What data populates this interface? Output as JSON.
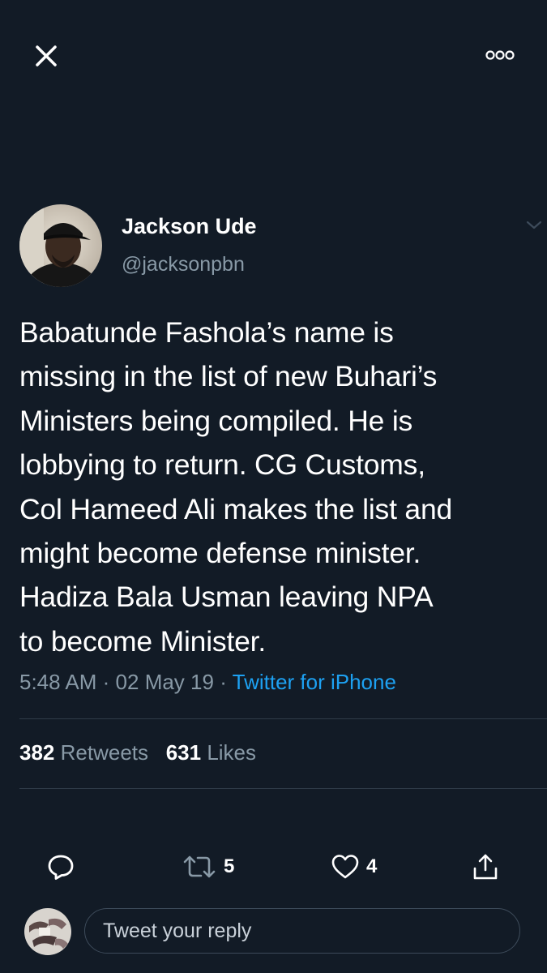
{
  "header": {
    "close_icon": "close-icon",
    "more_icon": "more-options-icon"
  },
  "tweet": {
    "author": {
      "display_name": "Jackson Ude",
      "handle": "@jacksonpbn",
      "avatar_icon": "profile-photo"
    },
    "text": "Babatunde Fashola’s name is\nmissing in the list of new Buhari’s\nMinisters being compiled. He is\nlobbying to return. CG Customs,\nCol Hameed Ali makes the list and\nmight become defense minister.\nHadiza Bala Usman leaving NPA\nto become Minister.",
    "time": "5:48 AM",
    "separator": "·",
    "date": "02 May 19",
    "source": "Twitter for iPhone",
    "source_color": "#1da1f2"
  },
  "stats": {
    "retweets_count": "382",
    "retweets_label": "Retweets",
    "likes_count": "631",
    "likes_label": "Likes"
  },
  "actions": {
    "reply_icon": "reply-icon",
    "retweet_icon": "retweet-icon",
    "retweet_count": "5",
    "like_icon": "heart-icon",
    "like_count": "4",
    "share_icon": "share-icon"
  },
  "reply": {
    "placeholder": "Tweet your reply"
  },
  "colors": {
    "background": "#121b26",
    "muted_text": "#8899a6",
    "accent": "#1da1f2",
    "divider": "#2f3b48"
  }
}
